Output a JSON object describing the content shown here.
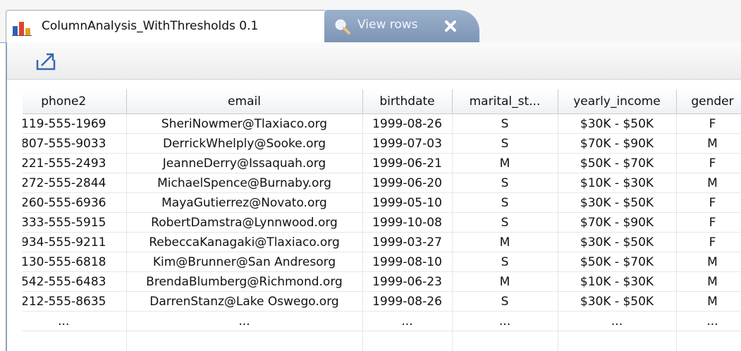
{
  "tabs": {
    "active": {
      "label": "ColumnAnalysis_WithThresholds 0.1",
      "icon": "bar-chart-icon"
    },
    "inactive": {
      "label": "View rows",
      "icon": "search-icon",
      "close_icon": "close-icon"
    }
  },
  "toolbar": {
    "export_icon": "export-icon"
  },
  "table": {
    "columns": [
      "phone2",
      "email",
      "birthdate",
      "marital_st...",
      "yearly_income",
      "gender"
    ],
    "rows": [
      [
        "119-555-1969",
        "SheriNowmer@Tlaxiaco.org",
        "1999-08-26",
        "S",
        "$30K - $50K",
        "F"
      ],
      [
        "807-555-9033",
        "DerrickWhelply@Sooke.org",
        "1999-07-03",
        "S",
        "$70K - $90K",
        "M"
      ],
      [
        "221-555-2493",
        "JeanneDerry@Issaquah.org",
        "1999-06-21",
        "M",
        "$50K - $70K",
        "F"
      ],
      [
        "272-555-2844",
        "MichaelSpence@Burnaby.org",
        "1999-06-20",
        "S",
        "$10K - $30K",
        "M"
      ],
      [
        "260-555-6936",
        "MayaGutierrez@Novato.org",
        "1999-05-10",
        "S",
        "$30K - $50K",
        "F"
      ],
      [
        "333-555-5915",
        "RobertDamstra@Lynnwood.org",
        "1999-10-08",
        "S",
        "$70K - $90K",
        "F"
      ],
      [
        "934-555-9211",
        "RebeccaKanagaki@Tlaxiaco.org",
        "1999-03-27",
        "M",
        "$30K - $50K",
        "F"
      ],
      [
        "130-555-6818",
        "Kim@Brunner@San Andresorg",
        "1999-08-10",
        "S",
        "$50K - $70K",
        "M"
      ],
      [
        "542-555-6483",
        "BrendaBlumberg@Richmond.org",
        "1999-06-23",
        "M",
        "$10K - $30K",
        "M"
      ],
      [
        "212-555-8635",
        "DarrenStanz@Lake Oswego.org",
        "1999-08-26",
        "S",
        "$30K - $50K",
        "M"
      ],
      [
        "...",
        "...",
        "...",
        "...",
        "...",
        "..."
      ]
    ]
  },
  "colors": {
    "tab_inactive": "#8ea4c2",
    "border": "#8ea1b7",
    "header_bg": "#eef1f4"
  }
}
